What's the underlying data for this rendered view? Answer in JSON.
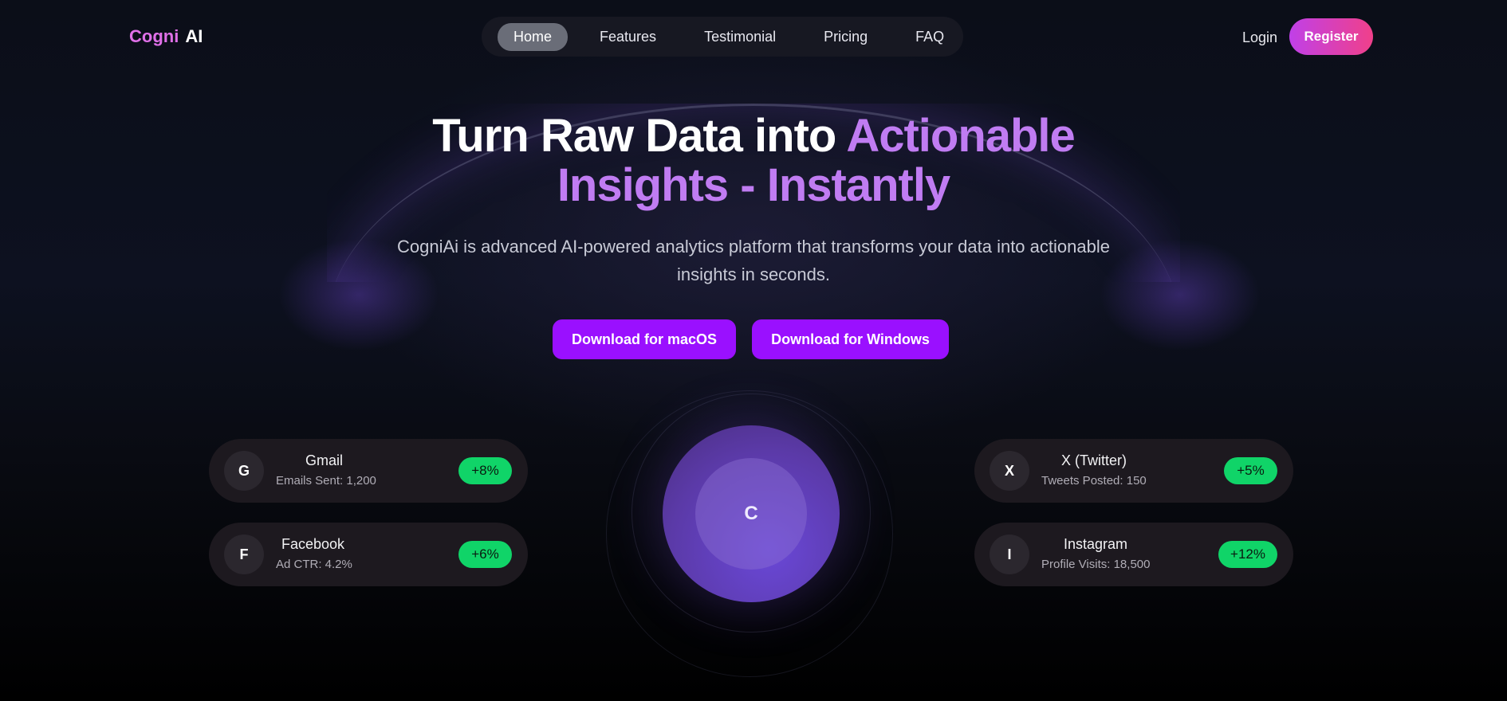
{
  "brand": {
    "part1": "Cogni",
    "part2": "AI"
  },
  "nav": {
    "items": [
      {
        "label": "Home",
        "active": true
      },
      {
        "label": "Features"
      },
      {
        "label": "Testimonial"
      },
      {
        "label": "Pricing"
      },
      {
        "label": "FAQ"
      }
    ],
    "login": "Login",
    "register": "Register"
  },
  "hero": {
    "headline_plain": "Turn Raw Data into ",
    "headline_accent_1": "Actionable",
    "headline_accent_2": "Insights - Instantly",
    "subtitle": "CogniAi is advanced AI-powered analytics platform that transforms your data into actionable insights in seconds.",
    "btn_mac": "Download for macOS",
    "btn_win": "Download for Windows"
  },
  "orb": {
    "letter": "C"
  },
  "cards": [
    {
      "initial": "G",
      "name": "Gmail",
      "metric": "Emails Sent: 1,200",
      "change": "+8%"
    },
    {
      "initial": "F",
      "name": "Facebook",
      "metric": "Ad CTR: 4.2%",
      "change": "+6%"
    },
    {
      "initial": "X",
      "name": "X (Twitter)",
      "metric": "Tweets Posted: 150",
      "change": "+5%"
    },
    {
      "initial": "I",
      "name": "Instagram",
      "metric": "Profile Visits: 18,500",
      "change": "+12%"
    }
  ],
  "colors": {
    "accent_purple": "#9a10ff",
    "headline_accent": "#c07cf2",
    "badge_green": "#10d468",
    "register_gradient_start": "#c040e8",
    "register_gradient_end": "#f0408a"
  }
}
